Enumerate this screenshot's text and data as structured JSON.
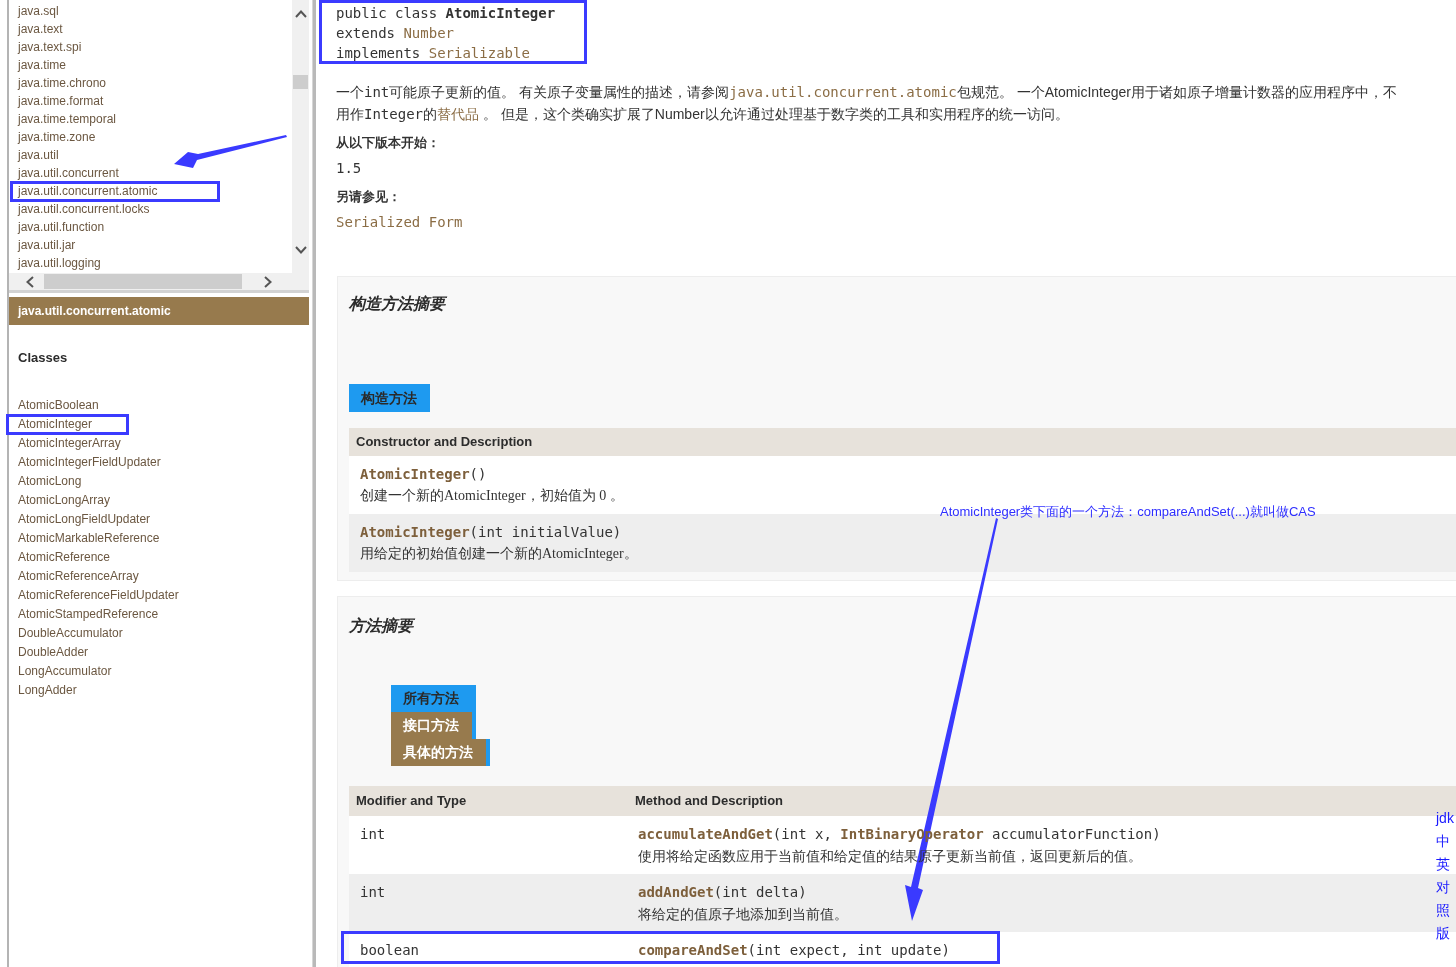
{
  "package_frame": {
    "items": [
      {
        "label": "java.sql",
        "annotated": false
      },
      {
        "label": "java.text",
        "annotated": false
      },
      {
        "label": "java.text.spi",
        "annotated": false
      },
      {
        "label": "java.time",
        "annotated": false
      },
      {
        "label": "java.time.chrono",
        "annotated": false
      },
      {
        "label": "java.time.format",
        "annotated": false
      },
      {
        "label": "java.time.temporal",
        "annotated": false
      },
      {
        "label": "java.time.zone",
        "annotated": false
      },
      {
        "label": "java.util",
        "annotated": false
      },
      {
        "label": "java.util.concurrent",
        "annotated": false
      },
      {
        "label": "java.util.concurrent.atomic",
        "annotated": true
      },
      {
        "label": "java.util.concurrent.locks",
        "annotated": false
      },
      {
        "label": "java.util.function",
        "annotated": false
      },
      {
        "label": "java.util.jar",
        "annotated": false
      },
      {
        "label": "java.util.logging",
        "annotated": false
      }
    ]
  },
  "package_header": {
    "title": "java.util.concurrent.atomic"
  },
  "class_frame": {
    "heading": "Classes",
    "items": [
      {
        "label": "AtomicBoolean",
        "annotated": false
      },
      {
        "label": "AtomicInteger",
        "annotated": true
      },
      {
        "label": "AtomicIntegerArray",
        "annotated": false
      },
      {
        "label": "AtomicIntegerFieldUpdater",
        "annotated": false
      },
      {
        "label": "AtomicLong",
        "annotated": false
      },
      {
        "label": "AtomicLongArray",
        "annotated": false
      },
      {
        "label": "AtomicLongFieldUpdater",
        "annotated": false
      },
      {
        "label": "AtomicMarkableReference",
        "annotated": false
      },
      {
        "label": "AtomicReference",
        "annotated": false
      },
      {
        "label": "AtomicReferenceArray",
        "annotated": false
      },
      {
        "label": "AtomicReferenceFieldUpdater",
        "annotated": false
      },
      {
        "label": "AtomicStampedReference",
        "annotated": false
      },
      {
        "label": "DoubleAccumulator",
        "annotated": false
      },
      {
        "label": "DoubleAdder",
        "annotated": false
      },
      {
        "label": "LongAccumulator",
        "annotated": false
      },
      {
        "label": "LongAdder",
        "annotated": false
      }
    ]
  },
  "class_signature": {
    "annotated": true,
    "lines": [
      [
        {
          "kind": "text",
          "text": "public class "
        },
        {
          "kind": "bold",
          "text": "AtomicInteger"
        }
      ],
      [
        {
          "kind": "text",
          "text": "extends "
        },
        {
          "kind": "link",
          "text": "Number"
        }
      ],
      [
        {
          "kind": "text",
          "text": "implements "
        },
        {
          "kind": "link",
          "text": "Serializable"
        }
      ]
    ]
  },
  "description": {
    "lines": [
      [
        {
          "kind": "text",
          "text": "一个"
        },
        {
          "kind": "code",
          "text": "int"
        },
        {
          "kind": "text",
          "text": "可能原子更新的值。 有关原子变量属性的描述，请参阅"
        },
        {
          "kind": "code_link",
          "text": "java.util.concurrent.atomic"
        },
        {
          "kind": "text",
          "text": "包规范。 一个AtomicInteger用于诸如原子增量计数器的应用程序中，不"
        }
      ],
      [
        {
          "kind": "text",
          "text": "用作"
        },
        {
          "kind": "code",
          "text": "Integer"
        },
        {
          "kind": "text",
          "text": "的"
        },
        {
          "kind": "link",
          "text": "替代品"
        },
        {
          "kind": "text",
          "text": " 。 但是，这个类确实扩展了Number以允许通过处理基于数字类的工具和实用程序的统一访问。"
        }
      ]
    ]
  },
  "since": {
    "label": "从以下版本开始：",
    "value": "1.5"
  },
  "see_also": {
    "label": "另请参见：",
    "link": "Serialized Form"
  },
  "constructor_summary": {
    "title": "构造方法摘要",
    "tabs": [
      {
        "label": "构造方法",
        "selected": true
      }
    ],
    "columns": [
      "Constructor and Description"
    ],
    "rows": [
      {
        "signature": [
          {
            "kind": "member",
            "text": "AtomicInteger"
          },
          {
            "kind": "code",
            "text": "()"
          }
        ],
        "description": "创建一个新的AtomicInteger，初始值为 0 。"
      },
      {
        "signature": [
          {
            "kind": "member",
            "text": "AtomicInteger"
          },
          {
            "kind": "code",
            "text": "(int initialValue)"
          }
        ],
        "description": "用给定的初始值创建一个新的AtomicInteger。"
      }
    ]
  },
  "method_summary": {
    "title": "方法摘要",
    "tabs": [
      {
        "label": "所有方法",
        "selected": true
      },
      {
        "label": "接口方法",
        "selected": false
      },
      {
        "label": "具体的方法",
        "selected": false
      }
    ],
    "columns": [
      "Modifier and Type",
      "Method and Description"
    ],
    "rows": [
      {
        "modifier": "int",
        "signature": [
          {
            "kind": "member",
            "text": "accumulateAndGet"
          },
          {
            "kind": "code",
            "text": "(int x, "
          },
          {
            "kind": "type_link",
            "text": "IntBinaryOperator"
          },
          {
            "kind": "code",
            "text": " accumulatorFunction)"
          }
        ],
        "description": "使用将给定函数应用于当前值和给定值的结果原子更新当前值，返回更新后的值。",
        "annotated": false
      },
      {
        "modifier": "int",
        "signature": [
          {
            "kind": "member",
            "text": "addAndGet"
          },
          {
            "kind": "code",
            "text": "(int delta)"
          }
        ],
        "description": "将给定的值原子地添加到当前值。",
        "annotated": false
      },
      {
        "modifier": "boolean",
        "signature": [
          {
            "kind": "member",
            "text": "compareAndSet"
          },
          {
            "kind": "code",
            "text": "(int expect, int update)"
          }
        ],
        "annotated": true
      }
    ]
  },
  "annotations": {
    "note": "AtomicInteger类下面的一个方法：compareAndSet(...)就叫做CAS",
    "side_label": "jdk中英对照版"
  }
}
